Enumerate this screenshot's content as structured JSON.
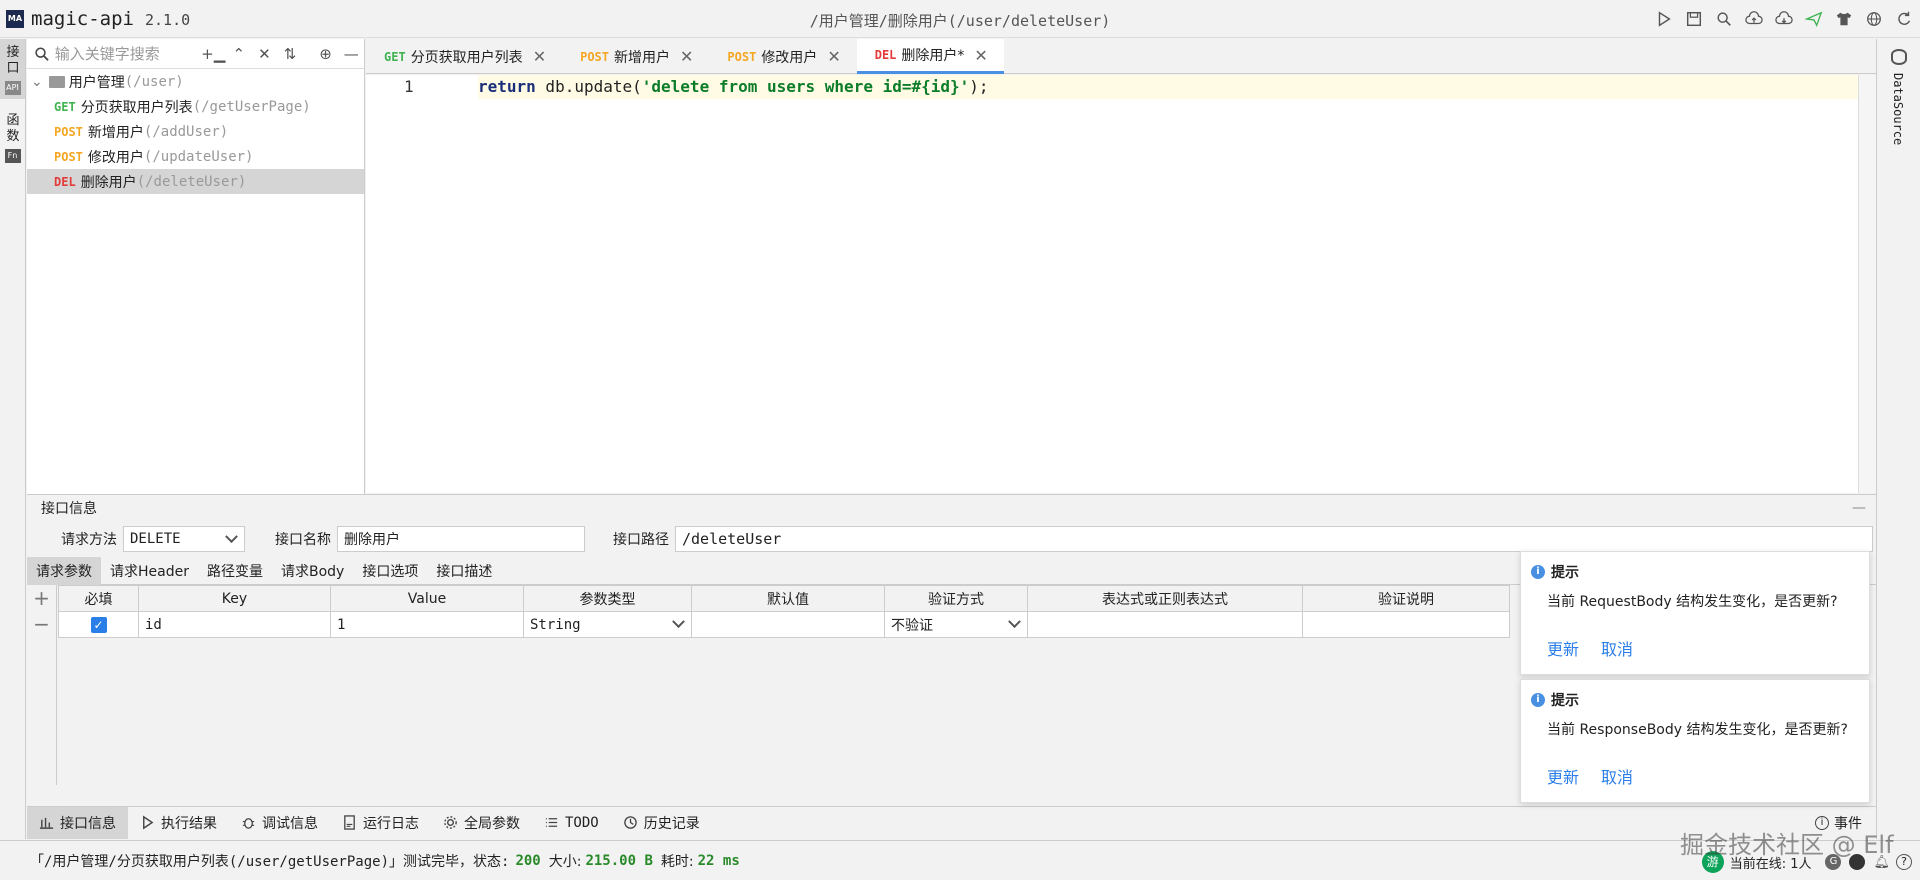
{
  "app": {
    "name": "magic-api",
    "version": "2.1.0",
    "window_title": "/用户管理/删除用户(/user/deleteUser)"
  },
  "toolbar": {
    "icons": [
      "run-icon",
      "save-icon",
      "search-icon",
      "upload-icon",
      "download-icon",
      "send-icon",
      "skin-icon",
      "globe-icon",
      "refresh-icon"
    ]
  },
  "left_rail": {
    "items": [
      {
        "label": "接口",
        "badge": "API"
      },
      {
        "label": "函数",
        "badge": "Fn"
      }
    ]
  },
  "right_rail": {
    "label": "DataSource"
  },
  "tree": {
    "search_placeholder": "输入关键字搜索",
    "group": {
      "name": "用户管理",
      "path": "(/user)"
    },
    "items": [
      {
        "method": "GET",
        "name": "分页获取用户列表",
        "path": "(/getUserPage)",
        "active": false
      },
      {
        "method": "POST",
        "name": "新增用户",
        "path": "(/addUser)",
        "active": false
      },
      {
        "method": "POST",
        "name": "修改用户",
        "path": "(/updateUser)",
        "active": false
      },
      {
        "method": "DEL",
        "name": "删除用户",
        "path": "(/deleteUser)",
        "active": true
      }
    ]
  },
  "tabs": [
    {
      "method": "GET",
      "label": "分页获取用户列表"
    },
    {
      "method": "POST",
      "label": "新增用户"
    },
    {
      "method": "POST",
      "label": "修改用户"
    },
    {
      "method": "DEL",
      "label": "删除用户*"
    }
  ],
  "editor": {
    "line_number": "1",
    "code": {
      "kw": "return",
      "call": " db.update(",
      "str": "'delete from users where id=#{id}'",
      "tail": ");"
    }
  },
  "panel": {
    "title": "接口信息",
    "method_label": "请求方法",
    "method_value": "DELETE",
    "name_label": "接口名称",
    "name_value": "删除用户",
    "path_label": "接口路径",
    "path_value": "/deleteUser",
    "subtabs": [
      "请求参数",
      "请求Header",
      "路径变量",
      "请求Body",
      "接口选项",
      "接口描述"
    ],
    "columns": [
      "必填",
      "Key",
      "Value",
      "参数类型",
      "默认值",
      "验证方式",
      "表达式或正则表达式",
      "验证说明"
    ],
    "rows": [
      {
        "required": true,
        "key": "id",
        "value": "1",
        "type": "String",
        "default": "",
        "validation": "不验证",
        "expression": "",
        "desc": ""
      }
    ]
  },
  "bottom_tabs": [
    "接口信息",
    "执行结果",
    "调试信息",
    "运行日志",
    "全局参数",
    "TODO",
    "历史记录"
  ],
  "event_label": "事件",
  "toasts": [
    {
      "title": "提示",
      "body": "当前 RequestBody 结构发生变化，是否更新?",
      "ok": "更新",
      "cancel": "取消"
    },
    {
      "title": "提示",
      "body": "当前 ResponseBody 结构发生变化，是否更新?",
      "ok": "更新",
      "cancel": "取消"
    }
  ],
  "status": {
    "prefix": "「/用户管理/分页获取用户列表(/user/getUserPage)」测试完毕，状态:",
    "code": "200",
    "size_label": "大小:",
    "size": "215.00 B",
    "time_label": "耗时:",
    "time": "22 ms",
    "online_badge": "游",
    "online": "当前在线: 1人"
  },
  "watermark": "掘金技术社区 @ Elf",
  "colors": {
    "get": "#40b352",
    "post": "#f5a623",
    "del": "#e33a3a",
    "accent": "#4a90e2"
  }
}
